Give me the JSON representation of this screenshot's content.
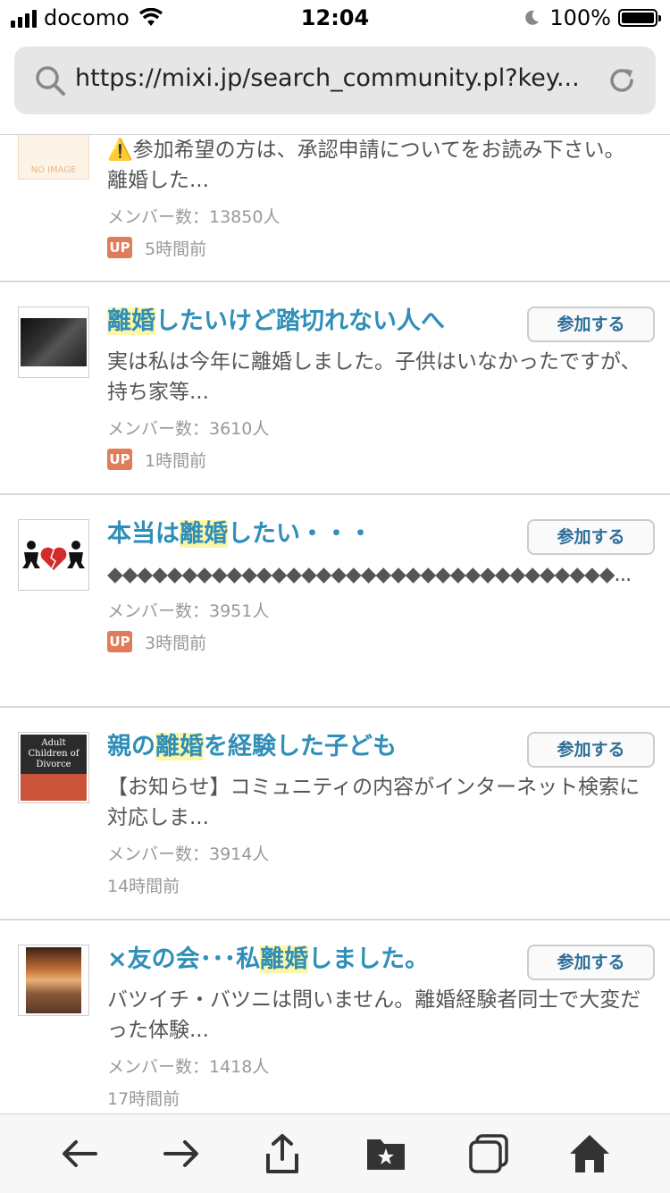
{
  "status": {
    "carrier": "docomo",
    "time": "12:04",
    "battery": "100%"
  },
  "browser": {
    "url": "https://mixi.jp/search_community.pl?key..."
  },
  "communities": [
    {
      "title_pre": "",
      "title_hl": "",
      "title_post": "",
      "desc": "⚠️参加希望の方は、承認申請についてをお読み下さい。離婚した...",
      "members": "メンバー数：13850人",
      "up": "UP",
      "time": "5時間前",
      "thumb": "NO IMAGE"
    },
    {
      "title_pre": "",
      "title_hl": "離婚",
      "title_post": "したいけど踏切れない人へ",
      "desc": "実は私は今年に離婚しました。子供はいなかったですが、持ち家等...",
      "members": "メンバー数：3610人",
      "up": "UP",
      "time": "1時間前",
      "join": "参加する"
    },
    {
      "title_pre": "本当は",
      "title_hl": "離婚",
      "title_post": "したい・・・",
      "desc": "◆◆◆◆◆◆◆◆◆◆◆◆◆◆◆◆◆◆◆◆◆◆◆◆◆◆◆◆◆◆◆◆◆◆...",
      "members": "メンバー数：3951人",
      "up": "UP",
      "time": "3時間前",
      "join": "参加する"
    },
    {
      "title_pre": "親の",
      "title_hl": "離婚",
      "title_post": "を経験した子ども",
      "desc": "【お知らせ】コミュニティの内容がインターネット検索に対応しま...",
      "members": "メンバー数：3914人",
      "time": "14時間前",
      "join": "参加する",
      "thumb_title": "Adult Children of Divorce"
    },
    {
      "title_pre": "×友の会･･･私",
      "title_hl": "離婚",
      "title_post": "しました。",
      "desc": "バツイチ・バツニは問いません。離婚経験者同士で大変だった体験...",
      "members": "メンバー数：1418人",
      "time": "17時間前",
      "join": "参加する"
    }
  ],
  "icons": {
    "back": "arrow-left-icon",
    "forward": "arrow-right-icon",
    "share": "share-icon",
    "bookmarks": "bookmark-star-icon",
    "tabs": "tabs-icon",
    "home": "home-icon"
  }
}
